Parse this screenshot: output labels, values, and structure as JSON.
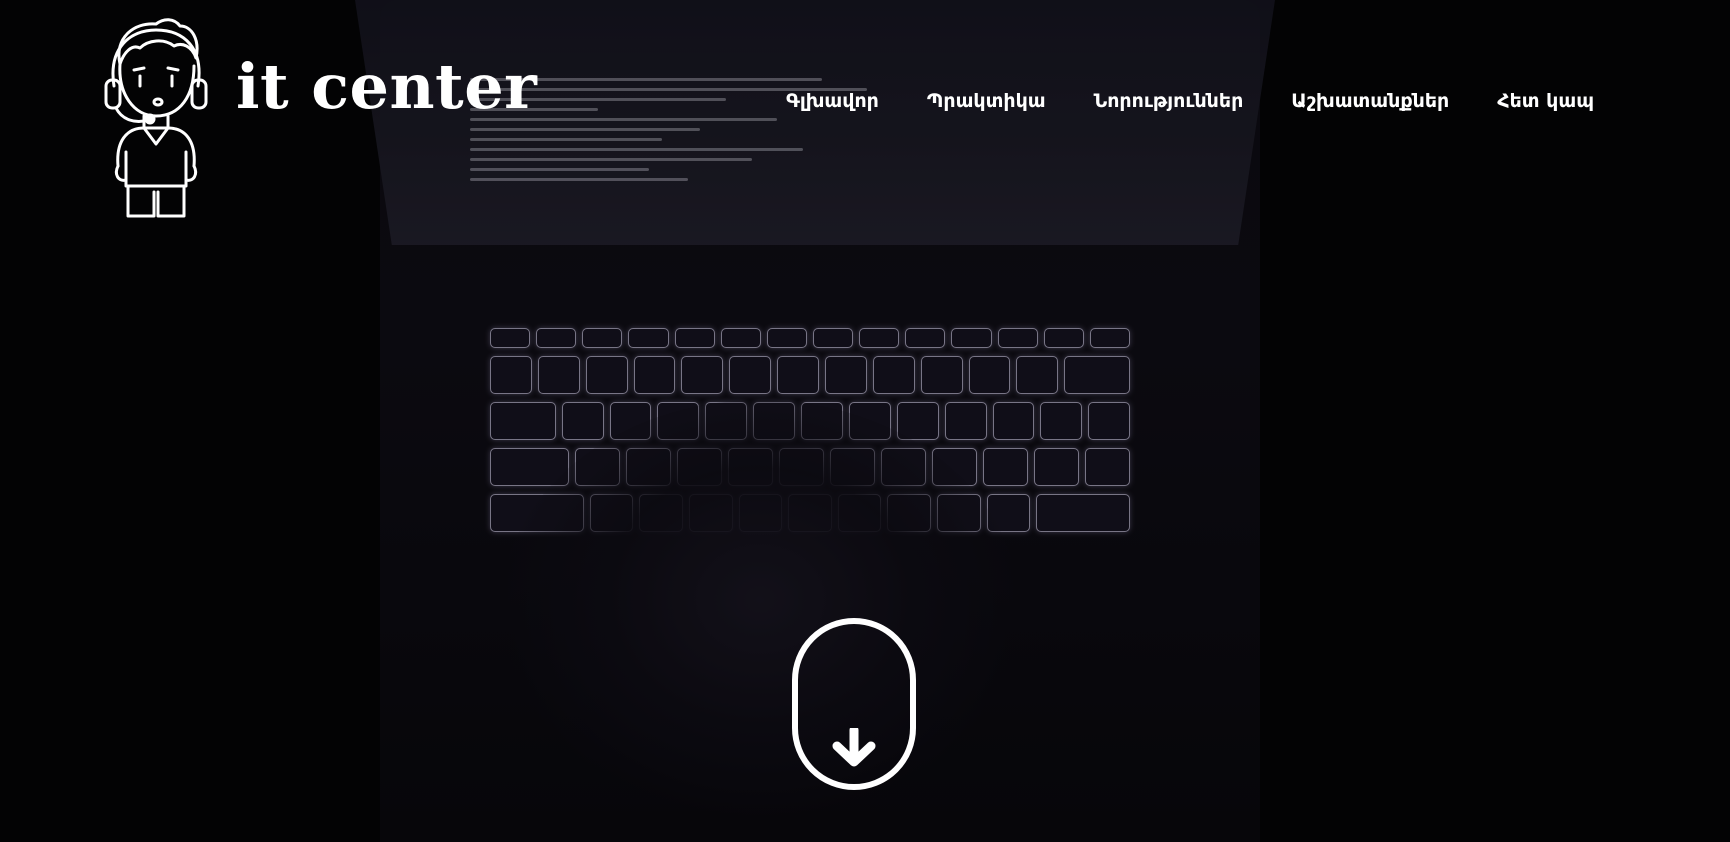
{
  "brand": {
    "name": "it center",
    "logo_icon": "headset-boy-icon"
  },
  "nav": {
    "items": [
      {
        "label": "Գլխավոր"
      },
      {
        "label": "Պրակտիկա"
      },
      {
        "label": "Նորություններ"
      },
      {
        "label": "Աշխատանքներ"
      },
      {
        "label": "Հետ կապ"
      }
    ]
  },
  "hero": {
    "background": "laptop-keyboard-hands-photo",
    "scroll_icon": "mouse-scroll-down-icon"
  },
  "colors": {
    "background": "#050507",
    "text": "#ffffff"
  }
}
